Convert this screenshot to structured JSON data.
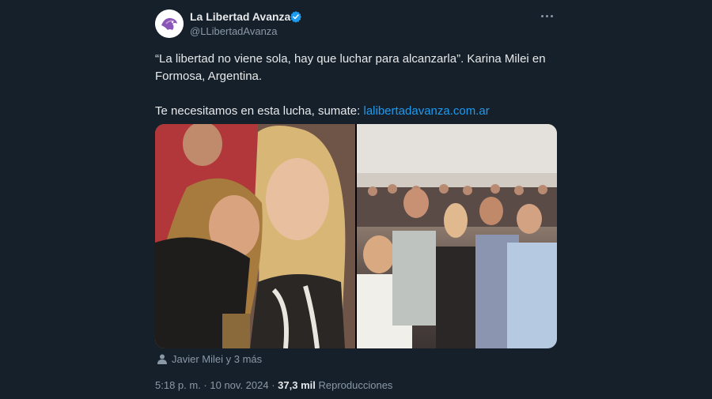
{
  "author": {
    "name": "La Libertad Avanza",
    "handle": "@LLibertadAvanza",
    "avatar_icon": "lla-lion-logo-icon",
    "verified_icon": "verified-badge-icon",
    "verified_color": "#1d9bf0"
  },
  "more_icon": "more-options-icon",
  "tweet": {
    "line1": "“La libertad no viene sola, hay que luchar para alcanzarla”. Karina Milei en Formosa, Argentina.",
    "line2_prefix": "Te necesitamos en esta lucha, sumate: ",
    "link": "lalibertadavanza.com.ar"
  },
  "media": {
    "photos": [
      {
        "alt_name": "photo-left"
      },
      {
        "alt_name": "photo-right"
      }
    ]
  },
  "tagged": {
    "icon": "person-icon",
    "label": "Javier Milei y 3 más"
  },
  "meta": {
    "time": "5:18 p. m.",
    "separator": " · ",
    "date": "10 nov. 2024",
    "views_count": "37,3 mil",
    "views_label": "Reproducciones"
  },
  "colors": {
    "background": "#15202b",
    "text": "#e7e9ea",
    "secondary": "#8b98a5",
    "link": "#1d9bf0"
  }
}
